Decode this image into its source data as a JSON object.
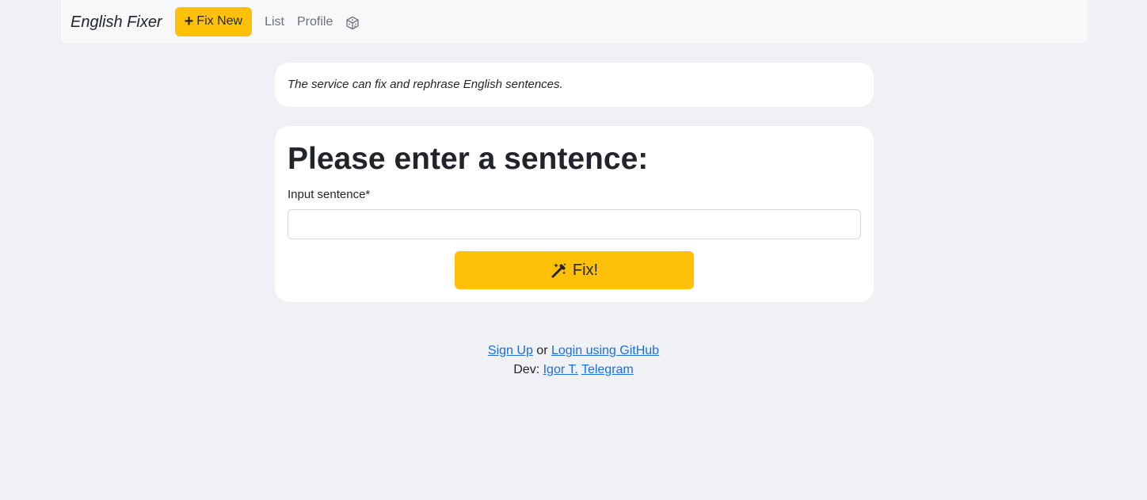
{
  "navbar": {
    "brand": "English Fixer",
    "fix_new_label": "Fix New",
    "links": [
      "List",
      "Profile"
    ]
  },
  "info": {
    "text": "The service can fix and rephrase English sentences."
  },
  "form": {
    "heading": "Please enter a sentence:",
    "input_label": "Input sentence*",
    "input_value": "",
    "submit_label": "Fix!"
  },
  "footer": {
    "signup_label": "Sign Up",
    "or_text": "or",
    "login_label": "Login using GitHub",
    "dev_prefix": "Dev:",
    "dev_name": "Igor T.",
    "telegram_label": "Telegram"
  },
  "colors": {
    "accent": "#ffc107",
    "background": "#f0f1f4",
    "link": "#1d6fe0"
  },
  "icons": {
    "fix_new": "plus-icon",
    "random": "dice-icon",
    "fix": "magic-wand-icon"
  }
}
